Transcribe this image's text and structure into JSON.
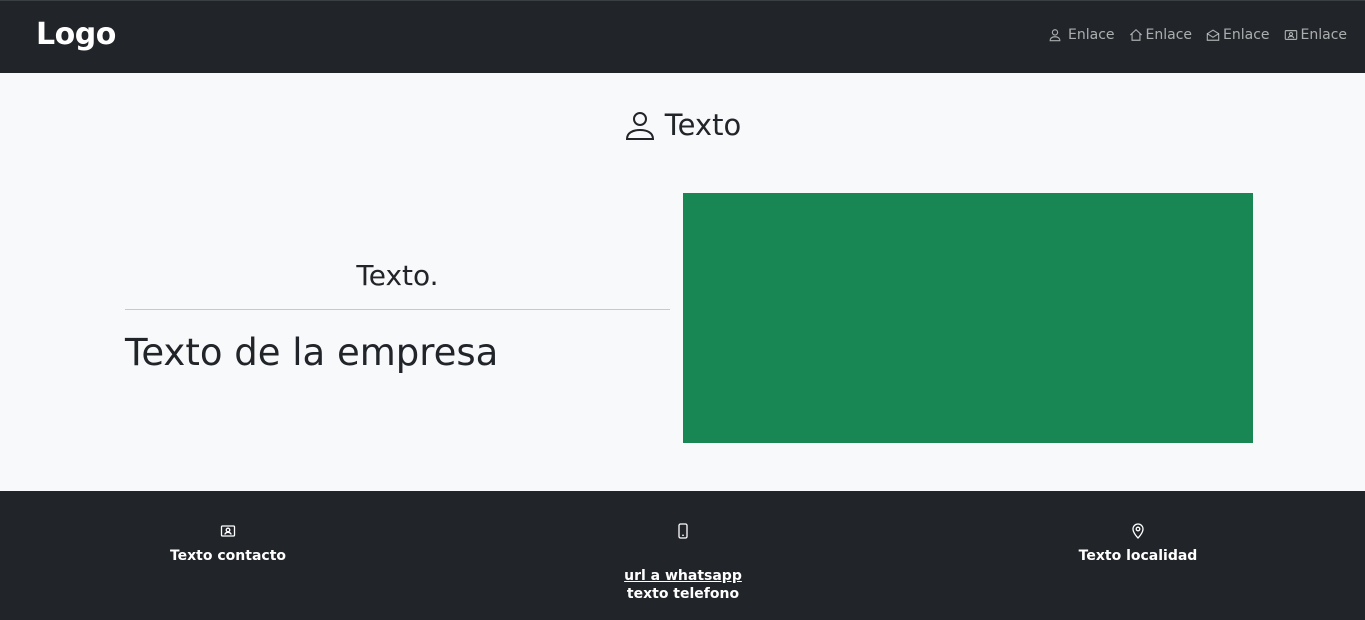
{
  "navbar": {
    "logo": "Logo",
    "links": [
      {
        "label": "Enlace",
        "icon": "person-icon"
      },
      {
        "label": "Enlace",
        "icon": "house-icon"
      },
      {
        "label": "Enlace",
        "icon": "envelope-open-icon"
      },
      {
        "label": "Enlace",
        "icon": "person-vcard-icon"
      }
    ]
  },
  "main": {
    "heading": "Texto",
    "subtitle": "Texto.",
    "company": "Texto de la empresa",
    "accent_color": "#198754"
  },
  "footer": {
    "contact": "Texto contacto",
    "whatsapp": "url a whatsapp",
    "phone": "texto telefono",
    "location": "Texto localidad"
  },
  "colors": {
    "dark": "#212529",
    "light": "#f8f9fa",
    "green": "#198754"
  }
}
